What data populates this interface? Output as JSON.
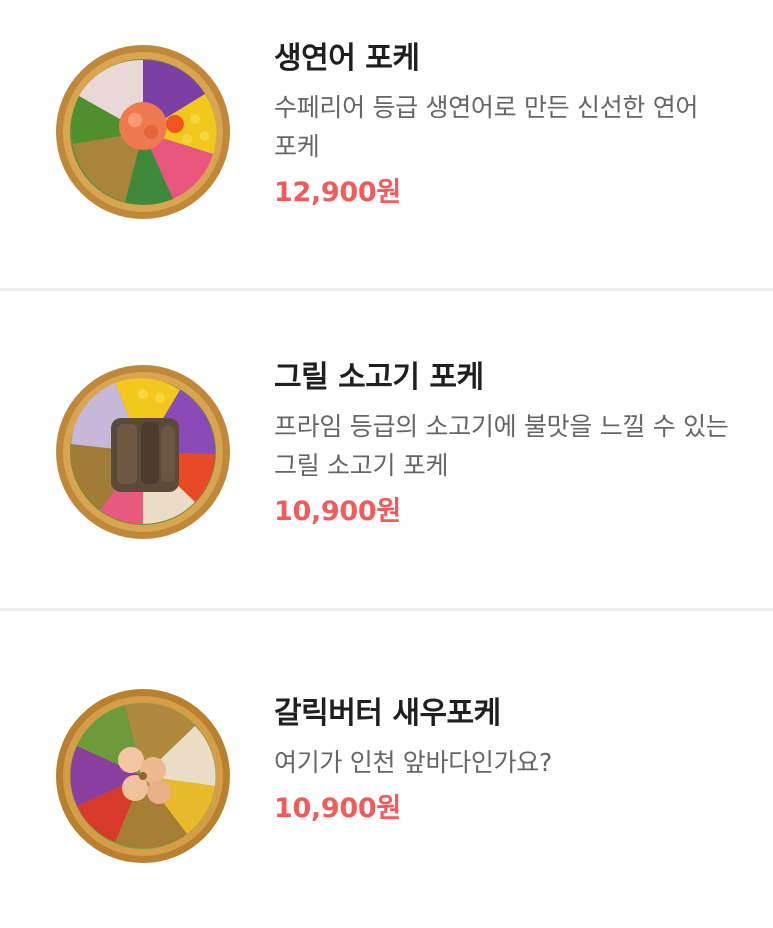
{
  "menu": {
    "items": [
      {
        "name": "생연어 포케",
        "description": "수페리어 등급 생연어로 만든 신선한 연어 포케",
        "price": "12,900원",
        "image_icon": "salmon-poke-bowl"
      },
      {
        "name": "그릴 소고기 포케",
        "description": "프라임 등급의 소고기에 불맛을 느낄 수 있는 그릴 소고기 포케",
        "price": "10,900원",
        "image_icon": "grilled-beef-poke-bowl"
      },
      {
        "name": "갈릭버터 새우포케",
        "description": "여기가 인천 앞바다인가요?",
        "price": "10,900원",
        "image_icon": "garlic-butter-shrimp-poke-bowl"
      }
    ]
  },
  "colors": {
    "price": "#f25b5b",
    "name": "#1f1f1f",
    "description": "#666666",
    "divider": "#eeeeee",
    "bowl": "#c99545"
  }
}
